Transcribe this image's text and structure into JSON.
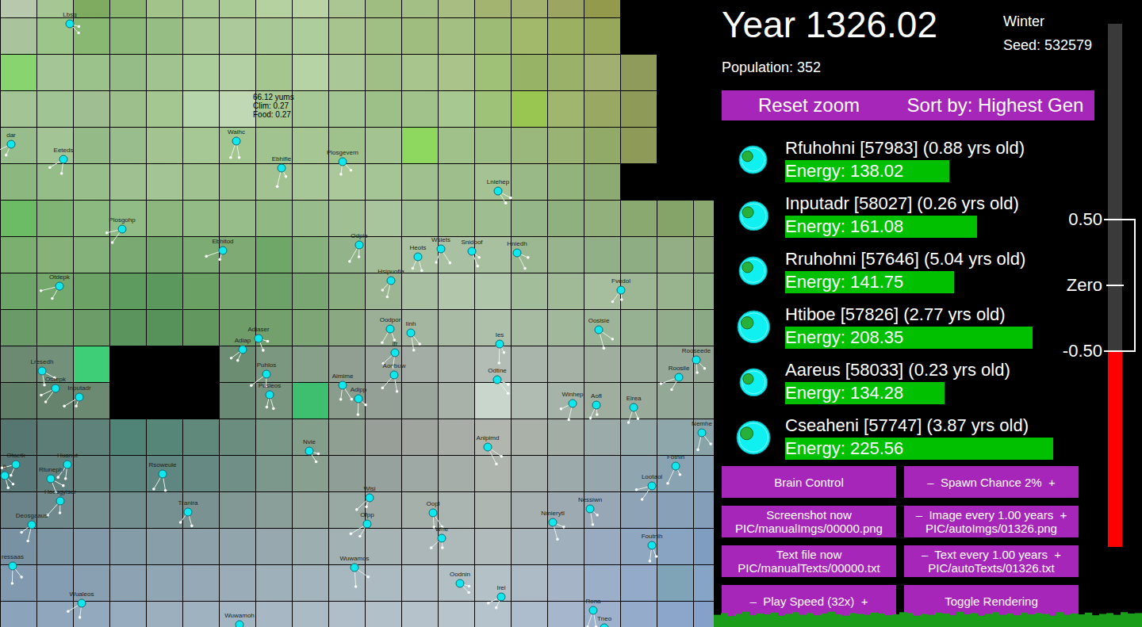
{
  "header": {
    "year": "Year 1326.02",
    "season": "Winter",
    "seed": "Seed: 532579",
    "population": "Population: 352"
  },
  "top_buttons": [
    {
      "label": "Reset zoom"
    },
    {
      "label": "Sort by: Highest Gen"
    }
  ],
  "creature_list": [
    {
      "label": "Rfuhohni [57983] (0.88 yrs old)",
      "energy": "Energy: 138.02",
      "level": 0.552
    },
    {
      "label": "Inputadr [58027] (0.26 yrs old)",
      "energy": "Energy: 161.08",
      "level": 0.644
    },
    {
      "label": "Rruhohni [57646] (5.04 yrs old)",
      "energy": "Energy: 141.75",
      "level": 0.567
    },
    {
      "label": "Htiboe [57826] (2.77 yrs old)",
      "energy": "Energy: 208.35",
      "level": 0.833
    },
    {
      "label": "Aareus [58033] (0.23 yrs old)",
      "energy": "Energy: 134.28",
      "level": 0.537
    },
    {
      "label": "Cseaheni [57747] (3.87 yrs old)",
      "energy": "Energy: 225.56",
      "level": 0.902
    }
  ],
  "controls": [
    {
      "lines": [
        "Brain Control"
      ]
    },
    {
      "lines": [
        "–  Spawn Chance 2%  +"
      ]
    },
    {
      "lines": [
        "Screenshot now",
        "PIC/manualImgs/00000.png"
      ]
    },
    {
      "lines": [
        "–  Image every 1.00 years  +",
        "PIC/autoImgs/01326.png"
      ]
    },
    {
      "lines": [
        "Text file now",
        "PIC/manualTexts/00000.txt"
      ]
    },
    {
      "lines": [
        "–  Text every 1.00 years  +",
        "PIC/autoTexts/01326.txt"
      ]
    },
    {
      "lines": [
        "–  Play Speed (32x)  +"
      ]
    },
    {
      "lines": [
        "Toggle Rendering"
      ]
    }
  ],
  "gauge": {
    "level": 0.374,
    "labels": [
      "0.50",
      "Zero",
      "-0.50"
    ]
  },
  "population_chart": {
    "values": [
      348,
      352,
      345,
      350,
      355,
      347,
      351,
      349,
      353,
      346,
      350,
      354,
      348,
      352,
      347,
      351,
      355,
      349,
      346,
      352,
      350,
      348,
      353,
      351,
      347,
      349,
      354,
      352,
      346,
      350,
      348,
      353,
      351,
      347,
      355,
      349,
      352,
      346,
      350,
      354,
      348,
      351,
      347,
      353,
      349,
      352,
      350,
      346,
      354,
      348,
      351,
      349,
      353,
      347,
      350,
      352,
      348,
      354,
      351,
      352
    ]
  },
  "map": {
    "tooltip": [
      "66.12 yums",
      "Clim: 0.27",
      "Food: 0.27"
    ],
    "creatures": [
      "Lbsg",
      "dar",
      "Eeteds",
      "Waihc",
      "Ebhifie",
      "Plosgevern",
      "Lniehep",
      "Plosgohp",
      "Ebhitod",
      "Odpie",
      "Heots",
      "Wsiets",
      "Snidoof",
      "Hniedh",
      "Otdepk",
      "Hsipuofia",
      "Fvedol",
      "Oodpor",
      "Iinh",
      "Oosisie",
      "Adiaser",
      "Adiap",
      "ifr",
      "Aonbuw",
      "Ies",
      "Rooseede",
      "Lresedh",
      "Otaepk",
      "Inputadr",
      "Puhlos",
      "Pusleos",
      "Aimime",
      "Adipp",
      "Odtine",
      "Roosile",
      "Winhep",
      "Aofl",
      "Eirea",
      "Nemhe",
      "Anipimd",
      "Nvie",
      "Otaetk",
      "Huanut",
      "Rsoweule",
      "Fotnih",
      "h",
      "Rtuneph",
      "Lootaol",
      "Wisi",
      "Hoosgyisar",
      "Tranira",
      "Oopl",
      "Nessiwn",
      "Nmierytl",
      "Ofpp",
      "Deosgaaus",
      "Whe",
      "Foutnih",
      "ressaas",
      "Wuwamos",
      "Oodnin",
      "Irei",
      "Wualeos",
      "Rona",
      "Tneo",
      "Wuwamoh"
    ],
    "tiles": [
      [
        "#b8c8ad",
        "#a6c694",
        "#7fab60",
        "#8bb672",
        "#a2c48b",
        "#a7c892",
        "#abcb96",
        "#b4d19f",
        "#b9d3a5",
        "#abc692",
        "#9fbd80",
        "#a3bf86",
        "#a8bd82",
        "#a2b470",
        "#a3b36f",
        "#9da563",
        "#949a4c",
        "#000000",
        "#000000",
        "#000000"
      ],
      [
        "#a9c49c",
        "#9cc58a",
        "#89b872",
        "#8cb87a",
        "#96bd83",
        "#a7c894",
        "#abc99a",
        "#a8c896",
        "#aecd9c",
        "#a7c48f",
        "#9fbf84",
        "#9fbd7e",
        "#a4bf82",
        "#9dbb74",
        "#a2b86b",
        "#9bb060",
        "#98a85a",
        "#000000",
        "#000000",
        "#000000"
      ],
      [
        "#88d46e",
        "#a4c697",
        "#9ac28a",
        "#95bb87",
        "#a0c390",
        "#abcd9c",
        "#b2d0a3",
        "#a6c690",
        "#b5d3a5",
        "#aac797",
        "#9fbf86",
        "#a9c58e",
        "#aac38a",
        "#9ec177",
        "#96b366",
        "#9ab169",
        "#a1b070",
        "#8e9b5a",
        "#000000",
        "#000000"
      ],
      [
        "#a3c596",
        "#a1c495",
        "#9fbe91",
        "#9dbf8b",
        "#a4c691",
        "#b7d5aa",
        "#c0d9b4",
        "#a8c994",
        "#a6c896",
        "#a3c493",
        "#9dc088",
        "#a1c38b",
        "#a7c890",
        "#9ec278",
        "#98c650",
        "#a0b56e",
        "#99a963",
        "#8d9a58",
        "#000000",
        "#000000"
      ],
      [
        "#98bd8c",
        "#a3c596",
        "#94ba87",
        "#99bd8c",
        "#a3c491",
        "#a6c894",
        "#a3c590",
        "#a1c38f",
        "#a6c793",
        "#9fc28d",
        "#a3c390",
        "#8ed860",
        "#a0c18a",
        "#9cbe86",
        "#9ab87c",
        "#98b374",
        "#92aa68",
        "#8e9a58",
        "#000000",
        "#000000"
      ],
      [
        "#8cb87f",
        "#94bd88",
        "#98be8c",
        "#9fc192",
        "#a3c495",
        "#a0c290",
        "#9cbf8c",
        "#a2c391",
        "#a8c798",
        "#aac899",
        "#a5c596",
        "#a0c18f",
        "#9ebe8b",
        "#a4c294",
        "#99ba86",
        "#93b37c",
        "#8cab73",
        "#000000",
        "#000000",
        "#000000"
      ],
      [
        "#6cbc66",
        "#7fb474",
        "#8bb980",
        "#92bc86",
        "#8db67f",
        "#93bb85",
        "#96bd8a",
        "#8fb882",
        "#98bc8b",
        "#a0c094",
        "#a8c59d",
        "#a1bf94",
        "#9cbc8e",
        "#9ebd91",
        "#95b689",
        "#8eb17f",
        "#91b07b",
        "#8aa970",
        "#84a46a",
        "#8aa870"
      ],
      [
        "#7aaf70",
        "#86b27a",
        "#84b07a",
        "#7aa972",
        "#72a46b",
        "#7cab74",
        "#7faa74",
        "#6ea768",
        "#86b07c",
        "#93b48a",
        "#a3bd99",
        "#aac2a2",
        "#a9c1a2",
        "#a8c0a0",
        "#9cb893",
        "#97b48e",
        "#92b088",
        "#8fad82",
        "#93ae84",
        "#8da97c"
      ],
      [
        "#6da569",
        "#74a86d",
        "#6ca266",
        "#5e9b5f",
        "#5a985d",
        "#6aa064",
        "#77a56f",
        "#6ea169",
        "#7aa673",
        "#8aad82",
        "#9cb694",
        "#a8bfa1",
        "#b1c6ab",
        "#b0c6aa",
        "#a2bd9a",
        "#a0ba97",
        "#a6bd9e",
        "#9db795",
        "#97b48f",
        "#90b088"
      ],
      [
        "#6a9a68",
        "#71a06d",
        "#6c9d68",
        "#5b955d",
        "#569259",
        "#62975f",
        "#6e9d69",
        "#73a06d",
        "#7ea576",
        "#8aa983",
        "#9aaf95",
        "#a4b69f",
        "#a9bba4",
        "#aec0aa",
        "#a7bba2",
        "#a1b89b",
        "#9cb497",
        "#96b191",
        "#91ad8b",
        "#8ca986"
      ],
      [
        "#6c8a72",
        "#73907a",
        "#3dce77",
        "#000000",
        "#000000",
        "#000000",
        "#6d8d73",
        "#7b977f",
        "#87a089",
        "#909f92",
        "#9ba79c",
        "#a4ada5",
        "#aab3ab",
        "#b4bdb5",
        "#a9b5aa",
        "#a4b1a4",
        "#9fae9f",
        "#9aab9b",
        "#96a897",
        "#92a593"
      ],
      [
        "#5f7f69",
        "#66846d",
        "#6c8a72",
        "#000000",
        "#000000",
        "#000000",
        "#6b8a75",
        "#7a957f",
        "#3ebf70",
        "#8a9d8d",
        "#949f95",
        "#9aa59b",
        "#a8b2a9",
        "#c8d6cc",
        "#b0bcb2",
        "#a6b3a8",
        "#9fae9f",
        "#9aab9c",
        "#94a897",
        "#8fa492"
      ],
      [
        "#557671",
        "#5c7c76",
        "#5f827a",
        "#4f8477",
        "#568677",
        "#60887b",
        "#6a8d80",
        "#789786",
        "#849e8c",
        "#8f9f92",
        "#989f98",
        "#a0a69f",
        "#a8aea7",
        "#b1b6ae",
        "#a9b1a9",
        "#a2ada5",
        "#9babaa",
        "#94a9a9",
        "#8da7aa",
        "#88a4a8"
      ],
      [
        "#5b7878",
        "#62807d",
        "#668480",
        "#5d857f",
        "#5f8680",
        "#668a83",
        "#708f86",
        "#7c978b",
        "#87a090",
        "#8f9f97",
        "#96a29e",
        "#9ea8a4",
        "#a6aea9",
        "#aeb4ae",
        "#a6b0ad",
        "#9daaab",
        "#96a8ae",
        "#8fa5b0",
        "#89a3b2",
        "#86a2b4"
      ],
      [
        "#6a8489",
        "#70898c",
        "#758e90",
        "#728e8f",
        "#769091",
        "#7a9392",
        "#829895",
        "#8b9f9a",
        "#93a49d",
        "#98a8a2",
        "#9eaba7",
        "#a5b0ab",
        "#aab4b0",
        "#aeb6b2",
        "#a6b0b1",
        "#9eaab2",
        "#97a7b6",
        "#8fa3b7",
        "#88a0b8",
        "#849eb9"
      ],
      [
        "#7892a3",
        "#7d96a6",
        "#8199a8",
        "#849ba8",
        "#889ea9",
        "#8ca1aa",
        "#91a5ac",
        "#97a9ae",
        "#9daeb1",
        "#a2b1b3",
        "#a7b4b5",
        "#abb7b8",
        "#aeb9ba",
        "#b1bbbc",
        "#a9b6bc",
        "#a0b0bd",
        "#98abc0",
        "#90a7c1",
        "#89a3c3",
        "#7f9dc1"
      ],
      [
        "#819ab0",
        "#859db2",
        "#89a0b3",
        "#8da3b4",
        "#91a6b5",
        "#95a9b6",
        "#99acb8",
        "#9eb0ba",
        "#a3b4bd",
        "#a8b8c0",
        "#acbbc2",
        "#b0bdc4",
        "#b2bfc5",
        "#b4c1c6",
        "#adbbc6",
        "#a5b5c7",
        "#9cafc9",
        "#94aac9",
        "#7fa4b8",
        "#86a5c6"
      ],
      [
        "#8ba3bb",
        "#8fa6bc",
        "#93a9bd",
        "#97acbe",
        "#9bafbf",
        "#9fb2c0",
        "#a3b5c2",
        "#a7b8c4",
        "#abbbc6",
        "#afbec8",
        "#b2c0ca",
        "#b5c2cb",
        "#b7c4cc",
        "#b5c3cd",
        "#aebdcd",
        "#a6b7cd",
        "#9db1cd",
        "#94abcc",
        "#8ca6cb",
        "#85a1c9"
      ]
    ]
  }
}
